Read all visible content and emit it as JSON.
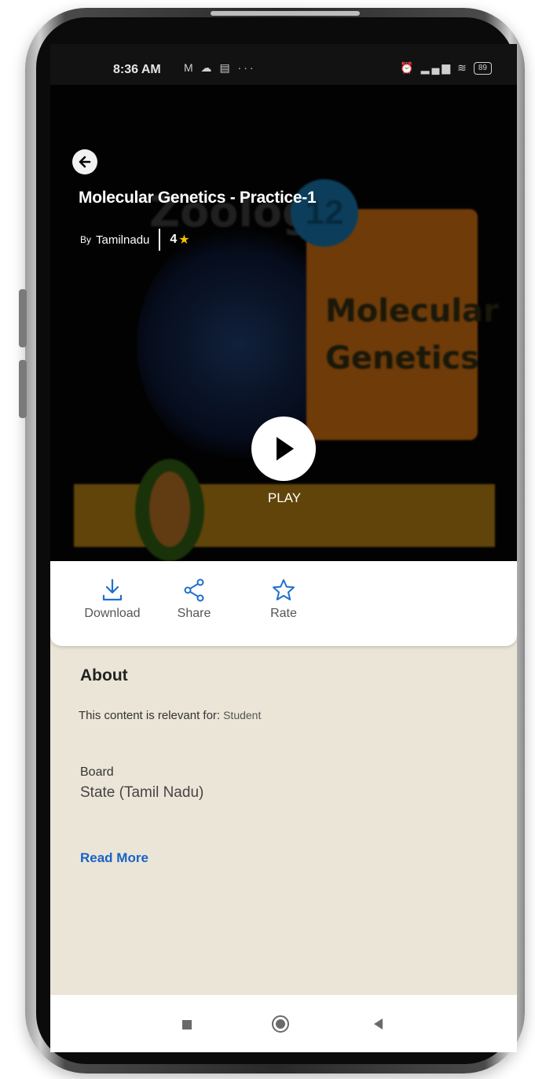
{
  "status_bar": {
    "time": "8:36 AM",
    "left_icons": "M ☁ ▤ ···",
    "battery": "89"
  },
  "hero": {
    "title": "Molecular Genetics - Practice-1",
    "by_prefix": "By",
    "author": "Tamilnadu",
    "rating": "4",
    "play_label": "PLAY",
    "thumbnail_text": {
      "subject": "Zoology",
      "grade": "12",
      "card_line1": "Molecular",
      "card_line2": "Genetics"
    }
  },
  "actions": [
    {
      "label": "Download",
      "icon": "download-icon"
    },
    {
      "label": "Share",
      "icon": "share-icon"
    },
    {
      "label": "Rate",
      "icon": "star-outline-icon"
    }
  ],
  "about": {
    "heading": "About",
    "relevant_label": "This content is relevant for:",
    "relevant_value": "Student",
    "board_label": "Board",
    "board_value": "State (Tamil Nadu)",
    "read_more": "Read More"
  },
  "colors": {
    "accent_link": "#1763c6",
    "action_icon": "#1e6fd0",
    "star": "#f6c200",
    "about_bg": "#ebe5d8"
  }
}
